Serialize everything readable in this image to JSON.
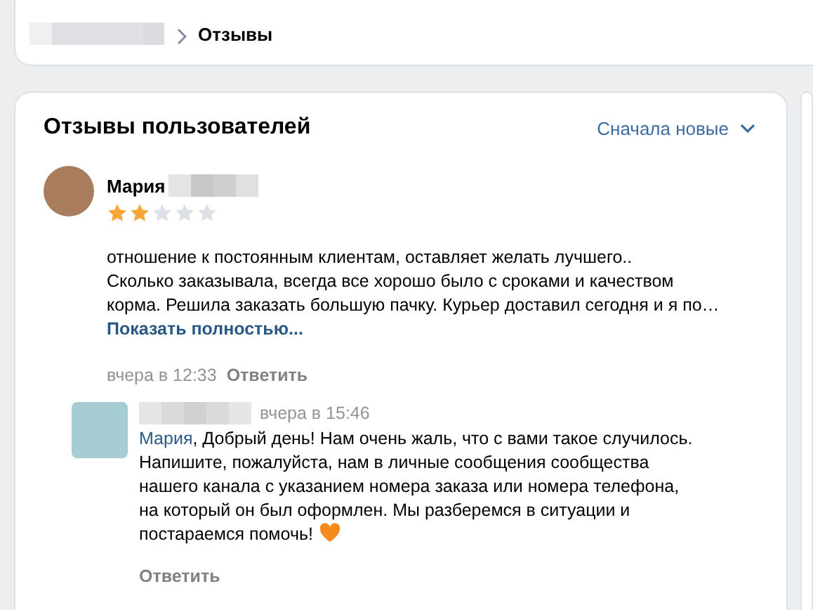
{
  "breadcrumb": {
    "current": "Отзывы"
  },
  "reviews_panel": {
    "title": "Отзывы пользователей",
    "sort": "Сначала новые"
  },
  "review": {
    "author": "Мария",
    "stars": 2,
    "text": "отношение к постоянным клиентам, оставляет желать лучшего..\nСколько заказывала, всегда все хорошо было с сроками и качеством\nкорма. Решила заказать большую пачку. Курьер доставил сегодня и я по…",
    "more_link": "Показать полностью...",
    "time": "вчера в 12:33",
    "reply_button": "Ответить",
    "reply": {
      "time": "вчера в 15:46",
      "addressee": "Мария",
      "text": ", Добрый день! Нам очень жаль, что с вами такое случилось.\nНапишите, пожалуйста, нам в личные сообщения сообщества\nнашего канала с указанием номера заказа или номера телефона,\nна который он был оформлен. Мы разберемся в ситуации и\nпостараемся помочь!",
      "reply_button": "Ответить"
    }
  }
}
